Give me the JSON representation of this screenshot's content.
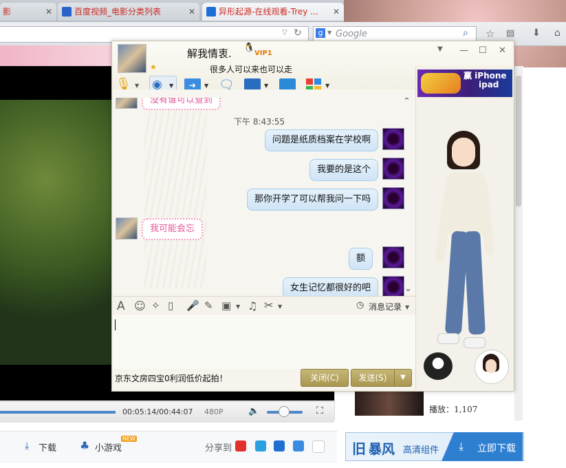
{
  "browser": {
    "tabs": [
      {
        "label": "影",
        "favicon_color": "#c0392b"
      },
      {
        "label": "百度视频_电影分类列表",
        "favicon_color": "#2a62c9"
      },
      {
        "label": "异形起源-在线观看-Trey ...",
        "favicon_color": "#1d6fd6"
      }
    ],
    "search_placeholder": "Google",
    "close_glyph": "✕"
  },
  "video": {
    "time": "00:05:14/00:44:07",
    "quality": "480P",
    "progress": 0.12,
    "volume": 0.45
  },
  "sidebar_list": {
    "plays": "播放：1,107"
  },
  "bottom_bar": {
    "download": "下载",
    "mini_games": "小游戏",
    "new_badge": "NEW",
    "share_to": "分享到"
  },
  "baofeng": {
    "brand": "暴风",
    "component": "高清组件",
    "download_now": "立即下载"
  },
  "qq": {
    "contact_name": "解我情衷.",
    "vip_badge": "VIP1",
    "signature": "很多人可以来也可以走",
    "window_buttons": {
      "dropdown": "▼",
      "minimize": "—",
      "maximize": "☐",
      "close": "✕"
    },
    "messages": {
      "partial_top": "没有谁可以查到",
      "time": "下午 8:43:55",
      "m1": "问题是纸质档案在学校啊",
      "m2": "我要的是这个",
      "m3": "那你开学了可以帮我问一下吗",
      "m4": "我可能会忘",
      "m5": "额",
      "m6": "女生记忆都很好的吧"
    },
    "history_label": "消息记录",
    "ad_text": "京东文房四宝0利润低价起拍！",
    "close_button": "关闭(C)",
    "send_button": "发送(S)",
    "side_ad": {
      "line1": "赢 iPhone",
      "line2": "ipad"
    }
  }
}
